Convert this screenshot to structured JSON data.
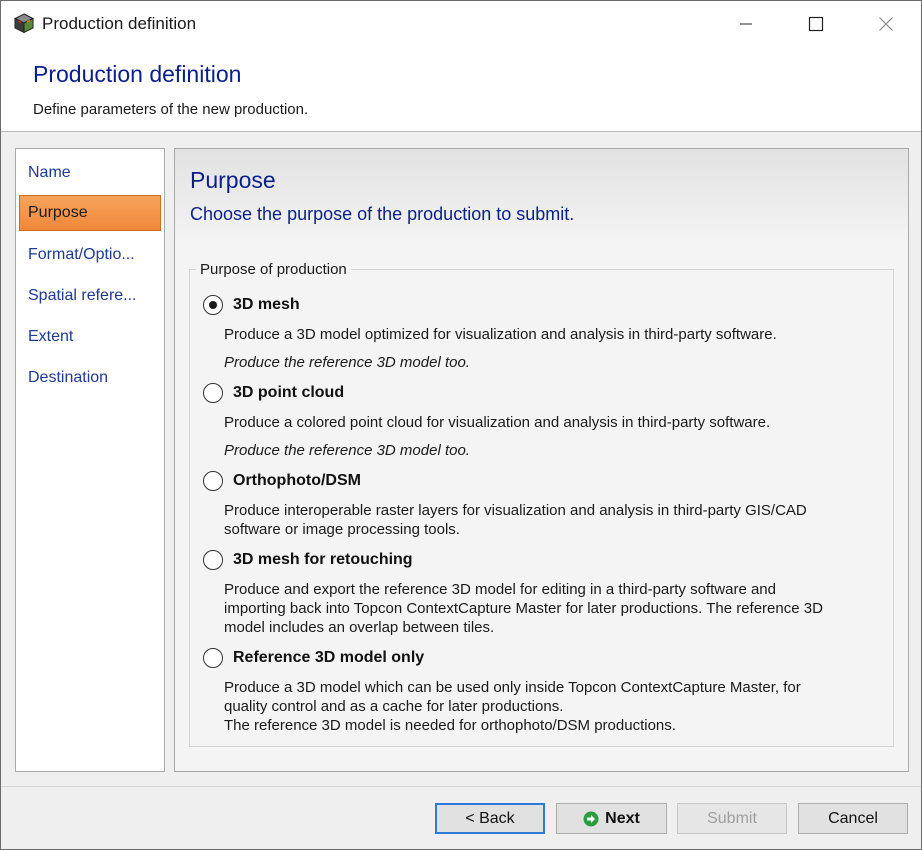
{
  "window": {
    "title": "Production definition"
  },
  "header": {
    "title": "Production definition",
    "subtitle": "Define parameters of the new production."
  },
  "sidebar": {
    "items": [
      {
        "label": "Name"
      },
      {
        "label": "Purpose",
        "active": true
      },
      {
        "label": "Format/Optio..."
      },
      {
        "label": "Spatial refere..."
      },
      {
        "label": "Extent"
      },
      {
        "label": "Destination"
      }
    ]
  },
  "main": {
    "title": "Purpose",
    "subtitle": "Choose the purpose of the production to submit.",
    "group_label": "Purpose of production",
    "options": [
      {
        "label": "3D mesh",
        "selected": true,
        "description": "Produce a 3D model optimized for visualization and analysis in third-party software.",
        "note": "Produce the reference 3D model too."
      },
      {
        "label": "3D point cloud",
        "selected": false,
        "description": "Produce a colored point cloud for visualization and analysis in third-party software.",
        "note": "Produce the reference 3D model too."
      },
      {
        "label": "Orthophoto/DSM",
        "selected": false,
        "description_lines": [
          "Produce interoperable raster layers for visualization and analysis in third-party GIS/CAD",
          "software or image processing tools."
        ]
      },
      {
        "label": "3D mesh for retouching",
        "selected": false,
        "description_lines": [
          "Produce and export the reference 3D model for editing in a third-party software and",
          "importing back into Topcon ContextCapture Master for later productions. The reference 3D",
          "model includes an overlap between tiles."
        ]
      },
      {
        "label": "Reference 3D model only",
        "selected": false,
        "description_lines": [
          "Produce a 3D model which can be used only inside Topcon ContextCapture Master, for",
          "quality control and as a cache for later productions.",
          "The reference 3D model is needed for orthophoto/DSM productions."
        ]
      }
    ]
  },
  "footer": {
    "back_label": "< Back",
    "next_label": "Next",
    "submit_label": "Submit",
    "cancel_label": "Cancel"
  },
  "colors": {
    "heading_blue": "#0b1f8a",
    "nav_blue": "#1f3a93",
    "active_orange": "#f0883a",
    "next_icon_green": "#2e9b3e"
  },
  "icons": {
    "app": "cube-icon",
    "next": "arrow-right-circle-icon"
  }
}
